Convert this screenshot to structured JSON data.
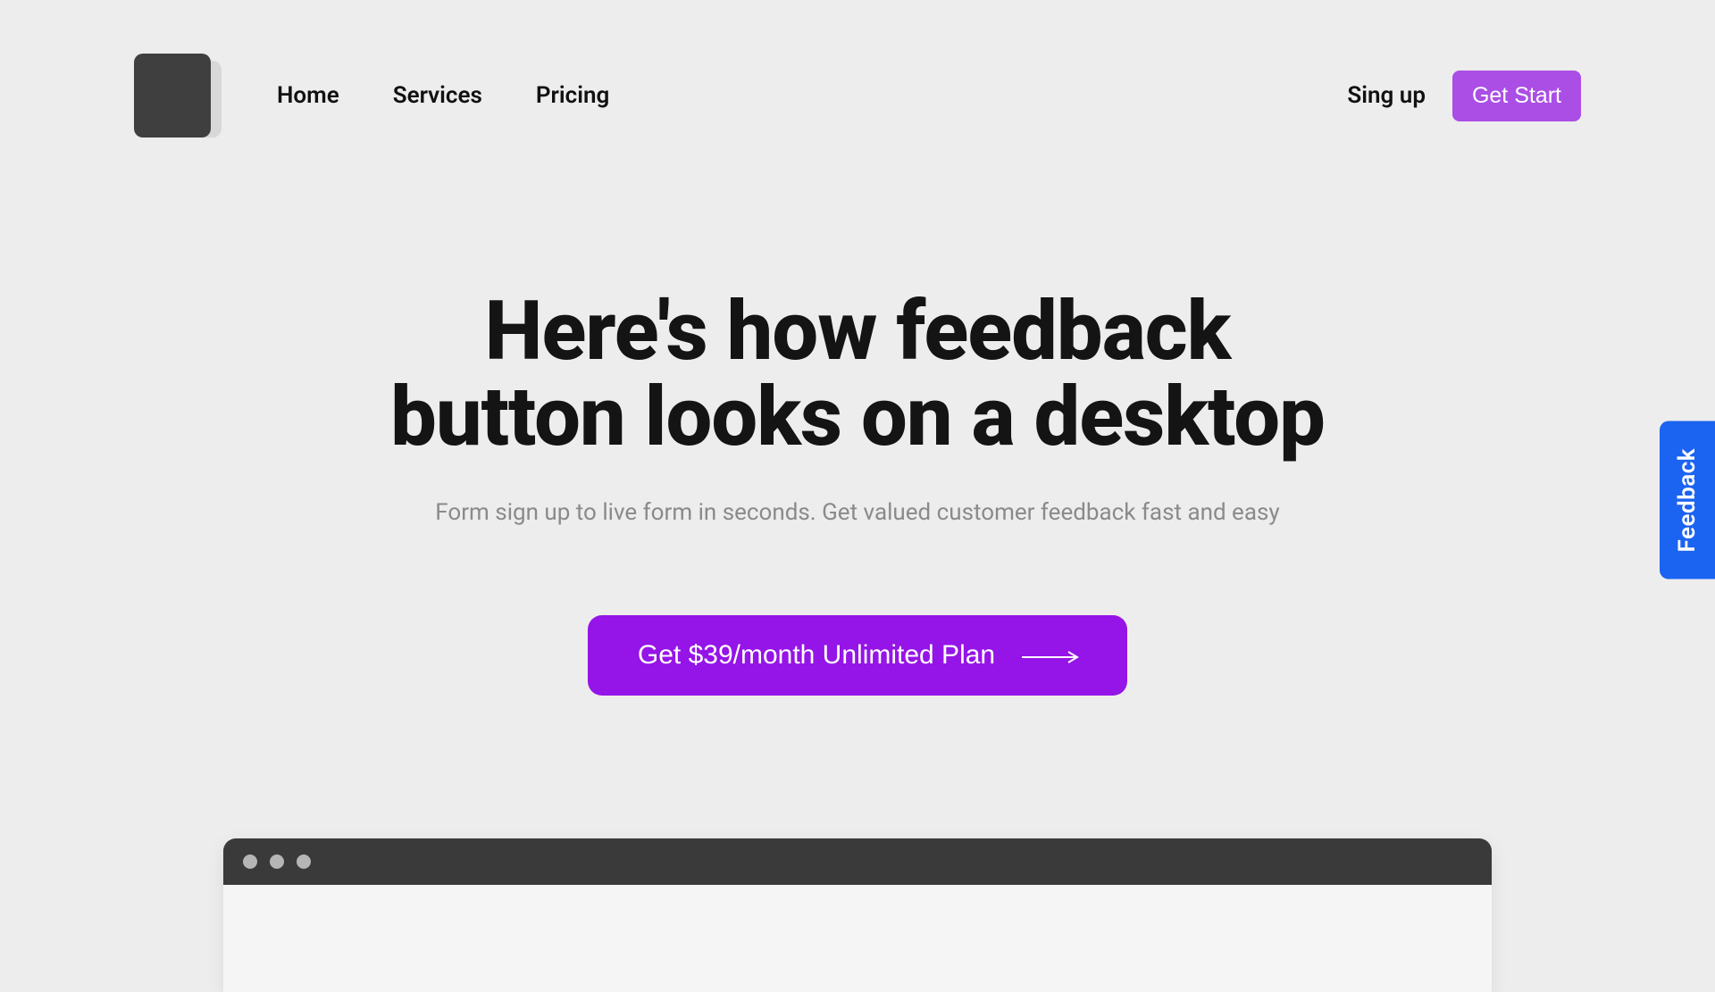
{
  "nav": {
    "items": [
      {
        "label": "Home"
      },
      {
        "label": "Services"
      },
      {
        "label": "Pricing"
      }
    ]
  },
  "header": {
    "signup_label": "Sing up",
    "get_start_label": "Get Start"
  },
  "hero": {
    "title_line1": "Here's how feedback",
    "title_line2": "button looks on a desktop",
    "subtitle": "Form sign up to live form in seconds. Get valued customer feedback fast and easy",
    "cta_label": "Get $39/month Unlimited Plan"
  },
  "feedback_tab": {
    "label": "Feedback"
  },
  "colors": {
    "primary_purple": "#9514e7",
    "light_purple": "#aa4ee5",
    "blue": "#1b63f1",
    "bg": "#ededed"
  }
}
